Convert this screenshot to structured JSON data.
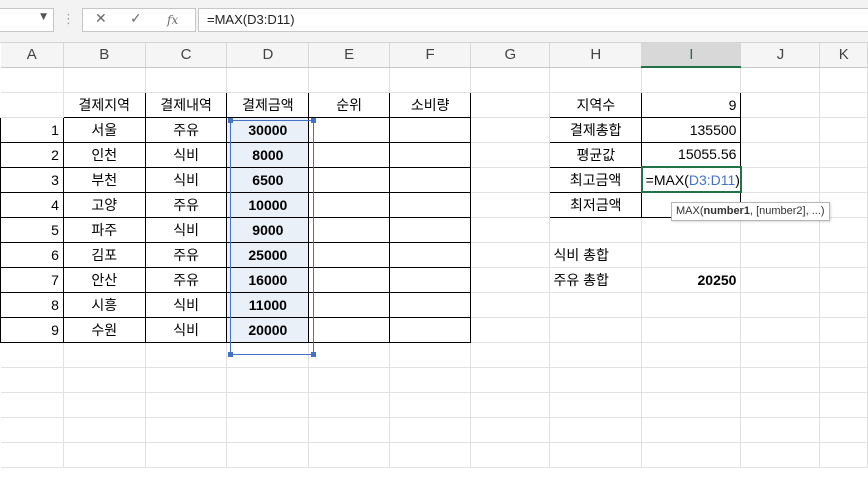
{
  "formula_bar": {
    "formula": "=MAX(D3:D11)",
    "cancel_icon": "✕",
    "enter_icon": "✓",
    "fx_label": "fx",
    "namebox_value": ""
  },
  "columns": [
    "A",
    "B",
    "C",
    "D",
    "E",
    "F",
    "G",
    "H",
    "I",
    "J",
    "K"
  ],
  "table": {
    "headers": [
      "결제지역",
      "결제내역",
      "결제금액",
      "순위",
      "소비량"
    ],
    "rows": [
      {
        "no": "1",
        "region": "서울",
        "item": "주유",
        "amount": "30000"
      },
      {
        "no": "2",
        "region": "인천",
        "item": "식비",
        "amount": "8000"
      },
      {
        "no": "3",
        "region": "부천",
        "item": "식비",
        "amount": "6500"
      },
      {
        "no": "4",
        "region": "고양",
        "item": "주유",
        "amount": "10000"
      },
      {
        "no": "5",
        "region": "파주",
        "item": "식비",
        "amount": "9000"
      },
      {
        "no": "6",
        "region": "김포",
        "item": "주유",
        "amount": "25000"
      },
      {
        "no": "7",
        "region": "안산",
        "item": "주유",
        "amount": "16000"
      },
      {
        "no": "8",
        "region": "시흥",
        "item": "식비",
        "amount": "11000"
      },
      {
        "no": "9",
        "region": "수원",
        "item": "식비",
        "amount": "20000"
      }
    ]
  },
  "summary": [
    {
      "label": "지역수",
      "value": "9"
    },
    {
      "label": "결제총합",
      "value": "135500"
    },
    {
      "label": "평균값",
      "value": "15055.56"
    },
    {
      "label": "최고금액",
      "value": ""
    },
    {
      "label": "최저금액",
      "value": ""
    }
  ],
  "editing": {
    "prefix": "=MAX(",
    "ref": "D3:D11",
    "suffix": ")"
  },
  "tooltip": {
    "func": "MAX(",
    "arg1": "number1",
    "rest": ", [number2], ...)"
  },
  "extra": [
    {
      "label": "식비 총합",
      "value": ""
    },
    {
      "label": "주유 총합",
      "value": "20250"
    }
  ]
}
